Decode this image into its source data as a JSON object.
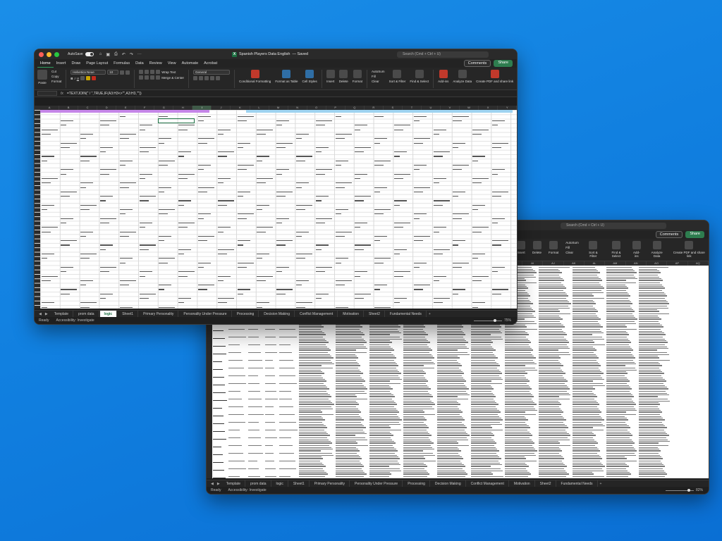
{
  "colors": {
    "excel_green": "#1d6f42",
    "share_green": "#2e7d4f",
    "light_red": "#ff5f57",
    "light_yellow": "#febc2e",
    "light_green": "#28c840",
    "desktop_blue": "#1180e0",
    "purple_band": "#c586e8",
    "blue_band": "#9fd3f0"
  },
  "front": {
    "autosave": "AutoSave",
    "title": "Spanish Players Data English",
    "saved": "— Saved",
    "search": "Search (Cmd + Ctrl + U)",
    "comments": "Comments",
    "share": "Share",
    "tabs": [
      "Home",
      "Insert",
      "Draw",
      "Page Layout",
      "Formulas",
      "Data",
      "Review",
      "View",
      "Automate",
      "Acrobat"
    ],
    "ribbon": {
      "paste": "Paste",
      "cut": "Cut",
      "copy": "Copy",
      "format": "Format",
      "font": "Helvetica Neue",
      "font_size": "10",
      "wrap": "Wrap Text",
      "merge": "Merge & Center",
      "number_format": "General",
      "cond": "Conditional Formatting",
      "format_table": "Format as Table",
      "cell_styles": "Cell Styles",
      "insert": "Insert",
      "delete": "Delete",
      "format2": "Format",
      "autosum": "AutoSum",
      "fill": "Fill",
      "clear": "Clear",
      "sort": "Sort & Filter",
      "find": "Find & Select",
      "addins": "Add-ins",
      "analyze": "Analyze Data",
      "pdf": "Create PDF and share link"
    },
    "formula": "=TEXTJOIN(\" / \",TRUE,IF(A3:H3<>\"\",A3:H3,\"\"))",
    "columns": [
      "A",
      "B",
      "C",
      "D",
      "E",
      "F",
      "G",
      "H",
      "I",
      "J",
      "K",
      "L",
      "M",
      "N",
      "O",
      "P",
      "Q",
      "R",
      "S",
      "T",
      "U",
      "V",
      "W",
      "X",
      "Y"
    ],
    "sheet_tabs": [
      "Template",
      "prom data",
      "logic",
      "Sheet1",
      "Primary Personality",
      "Personality Under Pressure",
      "Processing",
      "Decision Making",
      "Conflict Management",
      "Motivation",
      "Sheet2",
      "Fundamental Needs"
    ],
    "status_ready": "Ready",
    "status_access": "Accessibility: Investigate",
    "zoom": "75%",
    "zoom_level": 0.75
  },
  "back": {
    "search": "Search (Cmd + Ctrl + U)",
    "comments": "Comments",
    "share": "Share",
    "ribbon": [
      "Insert",
      "Delete",
      "Format",
      "Sort & Filter",
      "Find & Select",
      "Add-ins",
      "Analyze Data",
      "Create PDF and share link"
    ],
    "autosum": "AutoSum",
    "fill": "Fill",
    "clear": "Clear",
    "columns": [
      "T",
      "U",
      "V",
      "W",
      "X",
      "Y",
      "Z",
      "AA",
      "AB",
      "AC",
      "AD",
      "AE",
      "AF",
      "AG",
      "AH",
      "AI",
      "AJ",
      "AK",
      "AL",
      "AM",
      "AN",
      "AO",
      "AP",
      "AQ"
    ],
    "sheet_tabs": [
      "Template",
      "prom data",
      "logic",
      "Sheet1",
      "Primary Personality",
      "Personality Under Pressure",
      "Processing",
      "Decision Making",
      "Conflict Management",
      "Motivation",
      "Sheet2",
      "Fundamental Needs"
    ],
    "status_ready": "Ready",
    "status_access": "Accessibility: Investigate",
    "zoom": "82%",
    "zoom_level": 0.82
  }
}
